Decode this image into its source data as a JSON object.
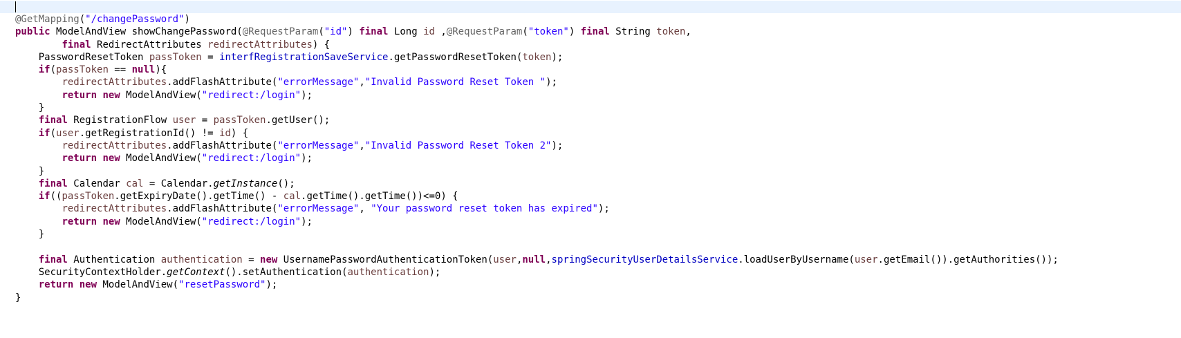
{
  "editor": {
    "language": "java",
    "colors": {
      "background": "#ffffff",
      "current_line": "#e8f2fe",
      "annotation": "#646464",
      "keyword": "#7f0055",
      "string": "#2a00ff",
      "local_variable": "#6a3e3e",
      "field": "#0000c0",
      "default": "#000000"
    },
    "lines": [
      [
        {
          "t": "ann",
          "v": "@GetMapping"
        },
        {
          "t": "plain",
          "v": "("
        },
        {
          "t": "str",
          "v": "\"/changePassword\""
        },
        {
          "t": "plain",
          "v": ")"
        }
      ],
      [
        {
          "t": "kw",
          "v": "public"
        },
        {
          "t": "plain",
          "v": " ModelAndView showChangePassword("
        },
        {
          "t": "ann",
          "v": "@RequestParam"
        },
        {
          "t": "plain",
          "v": "("
        },
        {
          "t": "str",
          "v": "\"id\""
        },
        {
          "t": "plain",
          "v": ") "
        },
        {
          "t": "kw",
          "v": "final"
        },
        {
          "t": "plain",
          "v": " Long "
        },
        {
          "t": "var",
          "v": "id"
        },
        {
          "t": "plain",
          "v": " ,"
        },
        {
          "t": "ann",
          "v": "@RequestParam"
        },
        {
          "t": "plain",
          "v": "("
        },
        {
          "t": "str",
          "v": "\"token\""
        },
        {
          "t": "plain",
          "v": ") "
        },
        {
          "t": "kw",
          "v": "final"
        },
        {
          "t": "plain",
          "v": " String "
        },
        {
          "t": "var",
          "v": "token"
        },
        {
          "t": "plain",
          "v": ","
        }
      ],
      [
        {
          "t": "plain",
          "v": "        "
        },
        {
          "t": "kw",
          "v": "final"
        },
        {
          "t": "plain",
          "v": " RedirectAttributes "
        },
        {
          "t": "var",
          "v": "redirectAttributes"
        },
        {
          "t": "plain",
          "v": ") {"
        }
      ],
      [
        {
          "t": "plain",
          "v": "    PasswordResetToken "
        },
        {
          "t": "var",
          "v": "passToken"
        },
        {
          "t": "plain",
          "v": " = "
        },
        {
          "t": "fld",
          "v": "interfRegistrationSaveService"
        },
        {
          "t": "plain",
          "v": ".getPasswordResetToken("
        },
        {
          "t": "var",
          "v": "token"
        },
        {
          "t": "plain",
          "v": ");"
        }
      ],
      [
        {
          "t": "plain",
          "v": "    "
        },
        {
          "t": "kw",
          "v": "if"
        },
        {
          "t": "plain",
          "v": "("
        },
        {
          "t": "var",
          "v": "passToken"
        },
        {
          "t": "plain",
          "v": " == "
        },
        {
          "t": "kw",
          "v": "null"
        },
        {
          "t": "plain",
          "v": "){"
        }
      ],
      [
        {
          "t": "plain",
          "v": "        "
        },
        {
          "t": "var",
          "v": "redirectAttributes"
        },
        {
          "t": "plain",
          "v": ".addFlashAttribute("
        },
        {
          "t": "str",
          "v": "\"errorMessage\""
        },
        {
          "t": "plain",
          "v": ","
        },
        {
          "t": "str",
          "v": "\"Invalid Password Reset Token \""
        },
        {
          "t": "plain",
          "v": ");"
        }
      ],
      [
        {
          "t": "plain",
          "v": "        "
        },
        {
          "t": "kw",
          "v": "return"
        },
        {
          "t": "plain",
          "v": " "
        },
        {
          "t": "kw",
          "v": "new"
        },
        {
          "t": "plain",
          "v": " ModelAndView("
        },
        {
          "t": "str",
          "v": "\"redirect:/login\""
        },
        {
          "t": "plain",
          "v": ");"
        }
      ],
      [
        {
          "t": "plain",
          "v": "    }"
        }
      ],
      [
        {
          "t": "plain",
          "v": "    "
        },
        {
          "t": "kw",
          "v": "final"
        },
        {
          "t": "plain",
          "v": " RegistrationFlow "
        },
        {
          "t": "var",
          "v": "user"
        },
        {
          "t": "plain",
          "v": " = "
        },
        {
          "t": "var",
          "v": "passToken"
        },
        {
          "t": "plain",
          "v": ".getUser();"
        }
      ],
      [
        {
          "t": "plain",
          "v": "    "
        },
        {
          "t": "kw",
          "v": "if"
        },
        {
          "t": "plain",
          "v": "("
        },
        {
          "t": "var",
          "v": "user"
        },
        {
          "t": "plain",
          "v": ".getRegistrationId() != "
        },
        {
          "t": "var",
          "v": "id"
        },
        {
          "t": "plain",
          "v": ") {"
        }
      ],
      [
        {
          "t": "plain",
          "v": "        "
        },
        {
          "t": "var",
          "v": "redirectAttributes"
        },
        {
          "t": "plain",
          "v": ".addFlashAttribute("
        },
        {
          "t": "str",
          "v": "\"errorMessage\""
        },
        {
          "t": "plain",
          "v": ","
        },
        {
          "t": "str",
          "v": "\"Invalid Password Reset Token 2\""
        },
        {
          "t": "plain",
          "v": ");"
        }
      ],
      [
        {
          "t": "plain",
          "v": "        "
        },
        {
          "t": "kw",
          "v": "return"
        },
        {
          "t": "plain",
          "v": " "
        },
        {
          "t": "kw",
          "v": "new"
        },
        {
          "t": "plain",
          "v": " ModelAndView("
        },
        {
          "t": "str",
          "v": "\"redirect:/login\""
        },
        {
          "t": "plain",
          "v": ");"
        }
      ],
      [
        {
          "t": "plain",
          "v": "    }"
        }
      ],
      [
        {
          "t": "plain",
          "v": "    "
        },
        {
          "t": "kw",
          "v": "final"
        },
        {
          "t": "plain",
          "v": " Calendar "
        },
        {
          "t": "var",
          "v": "cal"
        },
        {
          "t": "plain",
          "v": " = Calendar."
        },
        {
          "t": "static",
          "v": "getInstance"
        },
        {
          "t": "plain",
          "v": "();"
        }
      ],
      [
        {
          "t": "plain",
          "v": "    "
        },
        {
          "t": "kw",
          "v": "if"
        },
        {
          "t": "plain",
          "v": "(("
        },
        {
          "t": "var",
          "v": "passToken"
        },
        {
          "t": "plain",
          "v": ".getExpiryDate().getTime() - "
        },
        {
          "t": "var",
          "v": "cal"
        },
        {
          "t": "plain",
          "v": ".getTime().getTime())<=0) {"
        }
      ],
      [
        {
          "t": "plain",
          "v": "        "
        },
        {
          "t": "var",
          "v": "redirectAttributes"
        },
        {
          "t": "plain",
          "v": ".addFlashAttribute("
        },
        {
          "t": "str",
          "v": "\"errorMessage\""
        },
        {
          "t": "plain",
          "v": ", "
        },
        {
          "t": "str",
          "v": "\"Your password reset token has expired\""
        },
        {
          "t": "plain",
          "v": ");"
        }
      ],
      [
        {
          "t": "plain",
          "v": "        "
        },
        {
          "t": "kw",
          "v": "return"
        },
        {
          "t": "plain",
          "v": " "
        },
        {
          "t": "kw",
          "v": "new"
        },
        {
          "t": "plain",
          "v": " ModelAndView("
        },
        {
          "t": "str",
          "v": "\"redirect:/login\""
        },
        {
          "t": "plain",
          "v": ");"
        }
      ],
      [
        {
          "t": "plain",
          "v": "    }"
        }
      ],
      [],
      [
        {
          "t": "plain",
          "v": "    "
        },
        {
          "t": "kw",
          "v": "final"
        },
        {
          "t": "plain",
          "v": " Authentication "
        },
        {
          "t": "var",
          "v": "authentication"
        },
        {
          "t": "plain",
          "v": " = "
        },
        {
          "t": "kw",
          "v": "new"
        },
        {
          "t": "plain",
          "v": " UsernamePasswordAuthenticationToken("
        },
        {
          "t": "var",
          "v": "user"
        },
        {
          "t": "plain",
          "v": ","
        },
        {
          "t": "kw",
          "v": "null"
        },
        {
          "t": "plain",
          "v": ","
        },
        {
          "t": "fld",
          "v": "springSecurityUserDetailsService"
        },
        {
          "t": "plain",
          "v": ".loadUserByUsername("
        },
        {
          "t": "var",
          "v": "user"
        },
        {
          "t": "plain",
          "v": ".getEmail()).getAuthorities());"
        }
      ],
      [
        {
          "t": "plain",
          "v": "    SecurityContextHolder."
        },
        {
          "t": "static",
          "v": "getContext"
        },
        {
          "t": "plain",
          "v": "().setAuthentication("
        },
        {
          "t": "var",
          "v": "authentication"
        },
        {
          "t": "plain",
          "v": ");"
        }
      ],
      [
        {
          "t": "plain",
          "v": "    "
        },
        {
          "t": "kw",
          "v": "return"
        },
        {
          "t": "plain",
          "v": " "
        },
        {
          "t": "kw",
          "v": "new"
        },
        {
          "t": "plain",
          "v": " ModelAndView("
        },
        {
          "t": "str",
          "v": "\"resetPassword\""
        },
        {
          "t": "plain",
          "v": ");"
        }
      ],
      [
        {
          "t": "plain",
          "v": "}"
        }
      ]
    ]
  }
}
